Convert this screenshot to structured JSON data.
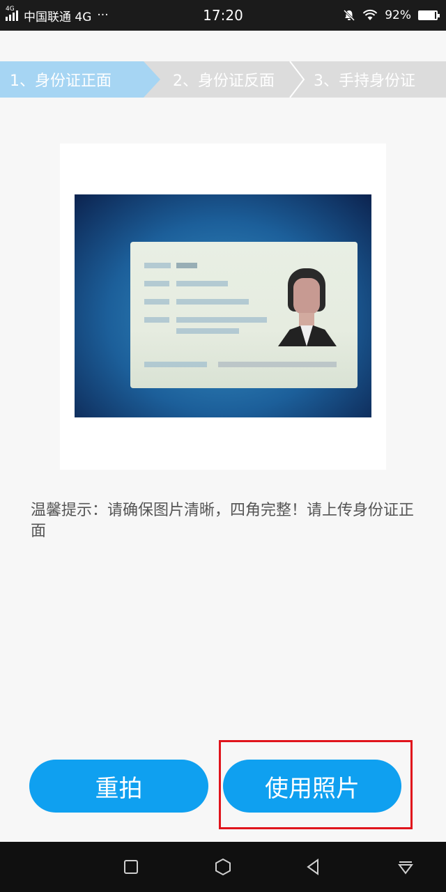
{
  "status_bar": {
    "network_tag": "4G",
    "carrier": "中国联通 4G",
    "dots": "···",
    "time": "17:20",
    "battery_percent": "92%",
    "battery_level": 0.92
  },
  "steps": [
    {
      "label": "1、身份证正面",
      "active": true
    },
    {
      "label": "2、身份证反面",
      "active": false
    },
    {
      "label": "3、手持身份证",
      "active": false
    }
  ],
  "tip_text": "温馨提示：请确保图片清晰，四角完整！请上传身份证正面",
  "buttons": {
    "retake": "重拍",
    "use_photo": "使用照片"
  },
  "colors": {
    "accent": "#0fa0f0",
    "active_step": "#a6d5f3",
    "inactive_step": "#dcdcdc",
    "highlight": "#e0141c"
  },
  "icons": {
    "nav_recent": "square-icon",
    "nav_home": "hexagon-icon",
    "nav_back": "triangle-back-icon",
    "nav_menu": "down-triangle-icon"
  }
}
